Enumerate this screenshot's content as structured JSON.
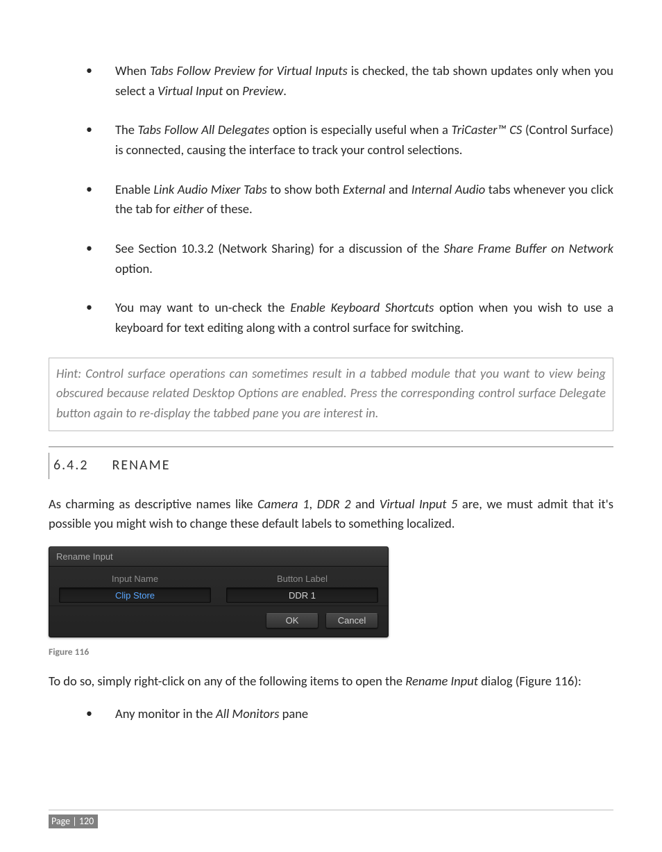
{
  "bullets_top": [
    {
      "pre": "When ",
      "i1": "Tabs Follow Preview for Virtual Inputs",
      "mid1": " is checked, the tab shown updates only when you select a ",
      "i2": "Virtual Input",
      "mid2": " on ",
      "i3": "Preview",
      "post": "."
    },
    {
      "pre": "The ",
      "i1": "Tabs Follow All Delegates",
      "mid1": " option is especially useful when a ",
      "i2": "TriCaster™ CS",
      "mid2": " (Control Surface) is connected, causing the interface to track your control selections.",
      "i3": "",
      "post": ""
    },
    {
      "pre": "Enable ",
      "i1": "Link Audio Mixer Tabs",
      "mid1": " to show both ",
      "i2": "External",
      "mid2": " and ",
      "i3": "Internal Audio",
      "post": " tabs whenever you click the tab for ",
      "i4": "either",
      "post2": " of these."
    },
    {
      "pre": "See Section 10.3.2 (Network Sharing) for a discussion of the ",
      "i1": "Share Frame Buffer on Network",
      "mid1": " option.",
      "i2": "",
      "mid2": "",
      "i3": "",
      "post": ""
    },
    {
      "pre": "You may want to un-check the ",
      "i1": "Enable Keyboard Shortcuts",
      "mid1": " option when you wish to use a keyboard for text editing along with a control surface for switching.",
      "i2": "",
      "mid2": "",
      "i3": "",
      "post": ""
    }
  ],
  "hint": "Hint: Control surface operations can sometimes result in a tabbed module that you want to view being obscured because related Desktop Options are enabled.  Press the corresponding control surface Delegate button again to re-display the tabbed pane you are interest in.",
  "section": {
    "num": "6.4.2",
    "title": "RENAME"
  },
  "para1": {
    "pre": "As charming as descriptive names like ",
    "i1": "Camera 1",
    "sep1": ", ",
    "i2": "DDR 2",
    "mid": " and ",
    "i3": "Virtual Input 5",
    "post": " are, we must admit that it's possible you might wish to change these default labels to something localized."
  },
  "dialog": {
    "title": "Rename Input",
    "input_name_label": "Input Name",
    "input_name_value": "Clip Store",
    "button_label_label": "Button Label",
    "button_label_value": "DDR 1",
    "ok": "OK",
    "cancel": "Cancel"
  },
  "figure_caption": "Figure 116",
  "para2": {
    "pre": "To do so, simply right-click on any of the following items to open the ",
    "i1": "Rename Input",
    "post": " dialog (Figure 116):"
  },
  "bullets_tail": [
    {
      "pre": "Any monitor in the ",
      "i1": "All Monitors",
      "post": " pane"
    }
  ],
  "footer": {
    "label": "Page |",
    "num": "120"
  }
}
